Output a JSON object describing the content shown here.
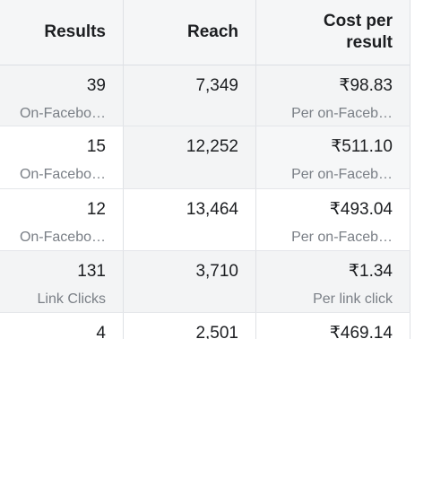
{
  "headers": {
    "results": "Results",
    "reach": "Reach",
    "cost_line1": "Cost per",
    "cost_line2": "result"
  },
  "rows": [
    {
      "results": "39",
      "results_type": "On-Facebo…",
      "reach": "7,349",
      "cost": "₹98.83",
      "cost_type": "Per on-Faceb…"
    },
    {
      "results": "15",
      "results_type": "On-Facebo…",
      "reach": "12,252",
      "cost": "₹511.10",
      "cost_type": "Per on-Faceb…"
    },
    {
      "results": "12",
      "results_type": "On-Facebo…",
      "reach": "13,464",
      "cost": "₹493.04",
      "cost_type": "Per on-Faceb…"
    },
    {
      "results": "131",
      "results_type": "Link Clicks",
      "reach": "3,710",
      "cost": "₹1.34",
      "cost_type": "Per link click"
    },
    {
      "results": "4",
      "results_type": "",
      "reach": "2,501",
      "cost": "₹469.14",
      "cost_type": ""
    }
  ]
}
